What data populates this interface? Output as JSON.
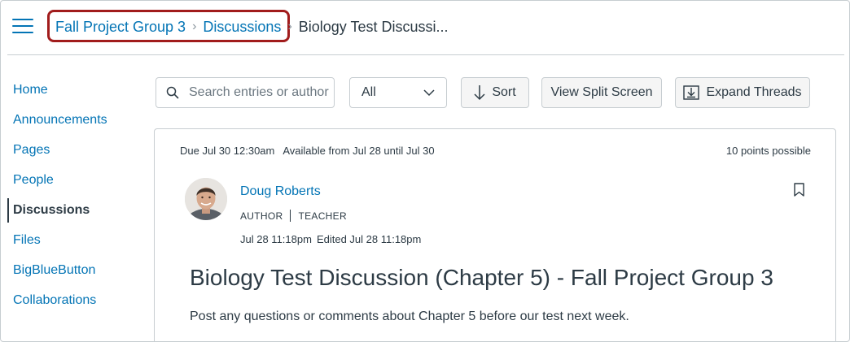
{
  "header": {
    "menu_icon": "hamburger-menu-icon",
    "breadcrumb": {
      "course": "Fall Project Group 3",
      "section": "Discussions",
      "current": "Biology Test Discussi..."
    }
  },
  "sidebar": {
    "items": [
      {
        "label": "Home",
        "active": false
      },
      {
        "label": "Announcements",
        "active": false
      },
      {
        "label": "Pages",
        "active": false
      },
      {
        "label": "People",
        "active": false
      },
      {
        "label": "Discussions",
        "active": true
      },
      {
        "label": "Files",
        "active": false
      },
      {
        "label": "BigBlueButton",
        "active": false
      },
      {
        "label": "Collaborations",
        "active": false
      }
    ]
  },
  "toolbar": {
    "search_placeholder": "Search entries or author",
    "filter_value": "All",
    "sort_label": "Sort",
    "split_label": "View Split Screen",
    "expand_label": "Expand Threads"
  },
  "topic": {
    "due": "Due Jul 30 12:30am",
    "available": "Available from Jul 28 until Jul 30",
    "points": "10 points possible",
    "author": "Doug Roberts",
    "role_author": "AUTHOR",
    "role_teacher": "TEACHER",
    "posted": "Jul 28 11:18pm",
    "edited": "Edited Jul 28 11:18pm",
    "title": "Biology Test Discussion (Chapter 5) - Fall Project Group 3",
    "body": "Post any questions or comments about Chapter 5 before our test next week."
  },
  "colors": {
    "link": "#0374b5",
    "text": "#2d3b45",
    "highlight_border": "#a11c1c",
    "border": "#c7cdd1"
  }
}
